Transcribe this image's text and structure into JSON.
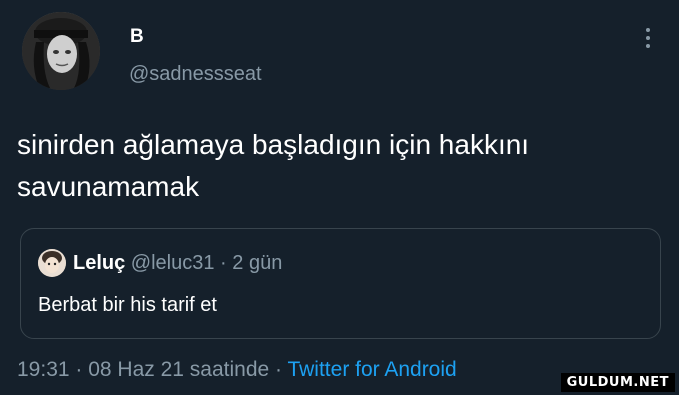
{
  "author": {
    "name": "B",
    "handle": "@sadnessseat"
  },
  "tweet": {
    "text_line1": "sinirden ağlamaya başladıgın için hakkını",
    "text_line2": "savunamamak"
  },
  "quote": {
    "name": "Leluç",
    "handle_time": " @leluc31 · 2 gün",
    "text": "Berbat bir his tarif et"
  },
  "footer": {
    "timestamp": "19:31 · 08 Haz 21 saatinde · ",
    "source": "Twitter for Android"
  },
  "watermark": "GULDUM.NET",
  "colors": {
    "background": "#15202b",
    "text_primary": "#ffffff",
    "text_secondary": "#8899a6",
    "link": "#1da1f2",
    "border": "#38444d"
  },
  "icons": {
    "more": "more-vertical-icon"
  }
}
